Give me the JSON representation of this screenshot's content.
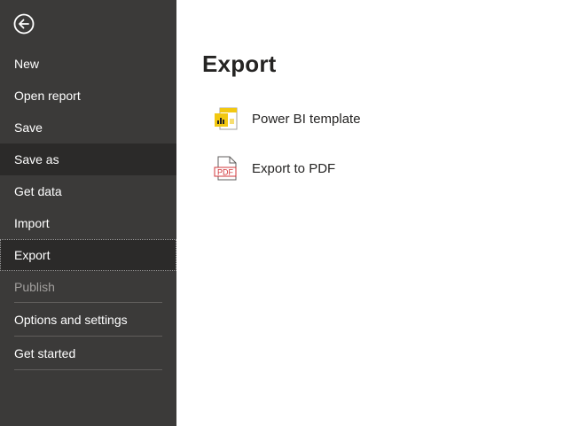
{
  "sidebar": {
    "items": [
      {
        "label": "New"
      },
      {
        "label": "Open report"
      },
      {
        "label": "Save"
      },
      {
        "label": "Save as"
      },
      {
        "label": "Get data"
      },
      {
        "label": "Import"
      },
      {
        "label": "Export"
      },
      {
        "label": "Publish"
      },
      {
        "label": "Options and settings"
      },
      {
        "label": "Get started"
      }
    ]
  },
  "main": {
    "title": "Export",
    "options": [
      {
        "label": "Power BI template"
      },
      {
        "label": "Export to PDF"
      }
    ],
    "pdf_icon_text": "PDF"
  },
  "colors": {
    "sidebar_bg": "#3b3a39",
    "accent_yellow": "#f2c811",
    "pdf_red": "#d13438"
  },
  "icons": {
    "back": "arrow-left-circle-icon",
    "template": "power-bi-template-icon",
    "pdf": "pdf-file-icon"
  }
}
